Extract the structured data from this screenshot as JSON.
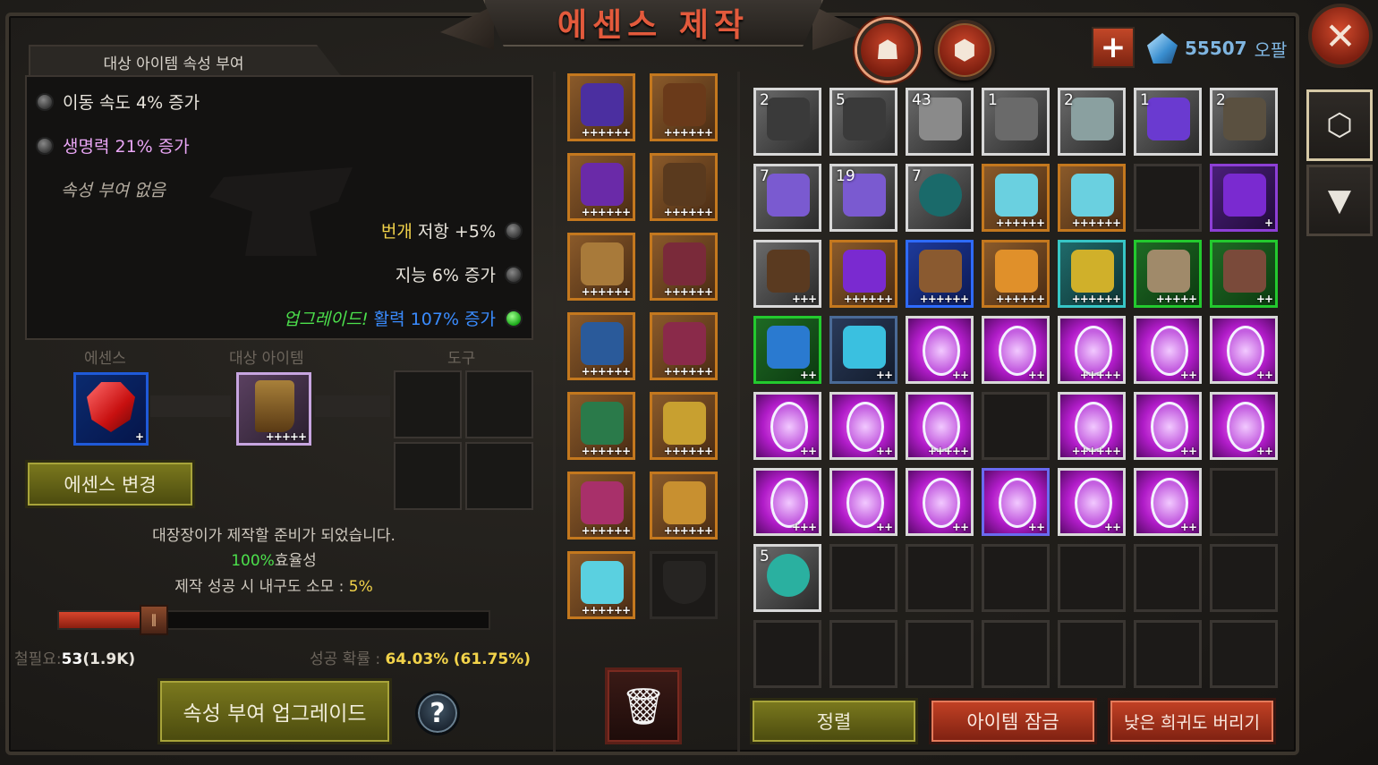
{
  "title": "에센스 제작",
  "currency": {
    "value": "55507",
    "unit": "오팔"
  },
  "attr_panel": {
    "tab_label": "대상 아이템 속성 부여",
    "rows": [
      {
        "text": "이동 속도 4% 증가",
        "color": "#e8e4dc"
      },
      {
        "text": "생명력 21% 증가",
        "color": "#e9a6f5"
      }
    ],
    "none_text": "속성 부여 없음",
    "right_rows": [
      {
        "prefix": "번개",
        "text": " 저항 +5%"
      },
      {
        "text": "지능 6% 증가"
      }
    ],
    "upgrade": {
      "prefix": "업그레이드!",
      "text": " 활력 107% 증가"
    }
  },
  "slots": {
    "essence_label": "에센스",
    "target_label": "대상 아이템",
    "tool_label": "도구",
    "essence_stars": "+",
    "target_stars": "+++++"
  },
  "buttons": {
    "change_essence": "에센스 변경",
    "upgrade": "속성 부여 업그레이드",
    "sort": "정렬",
    "lock": "아이템 잠금",
    "discard": "낮은 희귀도 버리기",
    "help": "?",
    "close": "✕",
    "plus": "+"
  },
  "status": {
    "ready": "대장장이가 제작할 준비가 되었습니다.",
    "efficiency_value": "100%",
    "efficiency_label": "효율성",
    "durability_label": "제작 성공 시 내구도 소모 : ",
    "durability_value": "5%",
    "iron_label": "철필요:",
    "iron_value": "53",
    "iron_total": "(1.9K)",
    "success_label": "성공 확률 : ",
    "success_value": "64.03%",
    "success_alt": "(61.75%)"
  },
  "slider": {
    "fill": 0.2
  },
  "equipment": [
    {
      "icon": "hat-icon",
      "stars": "++++++",
      "art": "#4b2fa0"
    },
    {
      "icon": "gloves-icon",
      "stars": "++++++",
      "art": "#6a3a1a"
    },
    {
      "icon": "amulet-icon",
      "stars": "++++++",
      "art": "#6a2aa8"
    },
    {
      "icon": "belt-icon",
      "stars": "++++++",
      "art": "#5a3a1e"
    },
    {
      "icon": "pauldron-icon",
      "stars": "++++++",
      "art": "#a87a3a"
    },
    {
      "icon": "pants-icon",
      "stars": "++++++",
      "art": "#7a2a3a"
    },
    {
      "icon": "armor-icon",
      "stars": "++++++",
      "art": "#2a5a9a"
    },
    {
      "icon": "boots-icon",
      "stars": "++++++",
      "art": "#8a2a4a"
    },
    {
      "icon": "cloak-icon",
      "stars": "++++++",
      "art": "#2a7a4a"
    },
    {
      "icon": "ring-icon",
      "stars": "++++++",
      "art": "#c8a030"
    },
    {
      "icon": "gem-bracer-icon",
      "stars": "++++++",
      "art": "#a8306a"
    },
    {
      "icon": "ring-icon",
      "stars": "++++++",
      "art": "#c89030"
    },
    {
      "icon": "crystal-icon",
      "stars": "++++++",
      "art": "#5ad0e0"
    },
    {
      "icon": "shield-slot-icon",
      "stars": "",
      "art": ""
    }
  ],
  "inventory": [
    {
      "icon": "anvil-icon",
      "count": "2",
      "stars": "",
      "rarity": "r-plain"
    },
    {
      "icon": "anvil-icon",
      "count": "5",
      "stars": "",
      "rarity": "r-plain"
    },
    {
      "icon": "ingot-icon",
      "count": "43",
      "stars": "",
      "rarity": "r-plain"
    },
    {
      "icon": "blade-icon",
      "count": "1",
      "stars": "",
      "rarity": "r-plain"
    },
    {
      "icon": "thread-icon",
      "count": "2",
      "stars": "",
      "rarity": "r-plain"
    },
    {
      "icon": "purple-crystal-icon",
      "count": "1",
      "stars": "",
      "rarity": "r-plain"
    },
    {
      "icon": "pyramid-icon",
      "count": "2",
      "stars": "",
      "rarity": "r-plain"
    },
    {
      "icon": "hammer-icon",
      "count": "7",
      "stars": "",
      "rarity": "r-plain"
    },
    {
      "icon": "hammer-icon",
      "count": "19",
      "stars": "",
      "rarity": "r-plain"
    },
    {
      "icon": "orb-icon",
      "count": "7",
      "stars": "",
      "rarity": "r-plain"
    },
    {
      "icon": "crystal-icon",
      "count": "",
      "stars": "++++++",
      "rarity": "r-orange"
    },
    {
      "icon": "crystal-icon",
      "count": "",
      "stars": "++++++",
      "rarity": "r-orange"
    },
    {
      "icon": "",
      "count": "",
      "stars": "",
      "rarity": "empty"
    },
    {
      "icon": "amulet-icon",
      "count": "",
      "stars": "+",
      "rarity": "r-purple"
    },
    {
      "icon": "bracer-icon",
      "count": "",
      "stars": "+++",
      "rarity": "r-plain"
    },
    {
      "icon": "amulet-icon",
      "count": "",
      "stars": "++++++",
      "rarity": "r-orange"
    },
    {
      "icon": "boots-icon",
      "count": "",
      "stars": "++++++",
      "rarity": "r-blue"
    },
    {
      "icon": "feather-icon",
      "count": "",
      "stars": "++++++",
      "rarity": "r-orange"
    },
    {
      "icon": "shield-icon",
      "count": "",
      "stars": "++++++",
      "rarity": "r-cyan"
    },
    {
      "icon": "dagger-icon",
      "count": "",
      "stars": "+++++",
      "rarity": "r-green"
    },
    {
      "icon": "wing-icon",
      "count": "",
      "stars": "++",
      "rarity": "r-green"
    },
    {
      "icon": "emblem-icon",
      "count": "",
      "stars": "++",
      "rarity": "r-green"
    },
    {
      "icon": "wand-icon",
      "count": "",
      "stars": "++",
      "rarity": "r-bluegray"
    },
    {
      "icon": "void-gem-icon",
      "count": "",
      "stars": "++",
      "rarity": "r-void"
    },
    {
      "icon": "void-gem-icon",
      "count": "",
      "stars": "++",
      "rarity": "r-void"
    },
    {
      "icon": "void-gem-icon",
      "count": "",
      "stars": "+++++",
      "rarity": "r-void"
    },
    {
      "icon": "void-gem-icon",
      "count": "",
      "stars": "++",
      "rarity": "r-void"
    },
    {
      "icon": "void-gem-icon",
      "count": "",
      "stars": "++",
      "rarity": "r-void"
    },
    {
      "icon": "void-gem-icon",
      "count": "",
      "stars": "++",
      "rarity": "r-void"
    },
    {
      "icon": "void-gem-icon",
      "count": "",
      "stars": "++",
      "rarity": "r-void"
    },
    {
      "icon": "void-gem-icon",
      "count": "",
      "stars": "+++++",
      "rarity": "r-void"
    },
    {
      "icon": "",
      "count": "",
      "stars": "",
      "rarity": "empty"
    },
    {
      "icon": "void-gem-icon",
      "count": "",
      "stars": "++++++",
      "rarity": "r-void"
    },
    {
      "icon": "void-gem-icon",
      "count": "",
      "stars": "++",
      "rarity": "r-void"
    },
    {
      "icon": "void-gem-icon",
      "count": "",
      "stars": "++",
      "rarity": "r-void"
    },
    {
      "icon": "void-gem-icon",
      "count": "",
      "stars": "+++",
      "rarity": "r-void"
    },
    {
      "icon": "void-gem-icon",
      "count": "",
      "stars": "++",
      "rarity": "r-void"
    },
    {
      "icon": "void-gem-icon",
      "count": "",
      "stars": "++",
      "rarity": "r-void"
    },
    {
      "icon": "void-gem-icon",
      "count": "",
      "stars": "++",
      "rarity": "r-void b-blue"
    },
    {
      "icon": "void-gem-icon",
      "count": "",
      "stars": "++",
      "rarity": "r-void"
    },
    {
      "icon": "void-gem-icon",
      "count": "",
      "stars": "++",
      "rarity": "r-void"
    },
    {
      "icon": "",
      "count": "",
      "stars": "",
      "rarity": "empty"
    },
    {
      "icon": "pearl-icon",
      "count": "5",
      "stars": "",
      "rarity": "r-plain"
    },
    {
      "icon": "",
      "count": "",
      "stars": "",
      "rarity": "empty"
    },
    {
      "icon": "",
      "count": "",
      "stars": "",
      "rarity": "empty"
    },
    {
      "icon": "",
      "count": "",
      "stars": "",
      "rarity": "empty"
    },
    {
      "icon": "",
      "count": "",
      "stars": "",
      "rarity": "empty"
    },
    {
      "icon": "",
      "count": "",
      "stars": "",
      "rarity": "empty"
    },
    {
      "icon": "",
      "count": "",
      "stars": "",
      "rarity": "empty"
    },
    {
      "icon": "",
      "count": "",
      "stars": "",
      "rarity": "empty"
    },
    {
      "icon": "",
      "count": "",
      "stars": "",
      "rarity": "empty"
    },
    {
      "icon": "",
      "count": "",
      "stars": "",
      "rarity": "empty"
    },
    {
      "icon": "",
      "count": "",
      "stars": "",
      "rarity": "empty"
    },
    {
      "icon": "",
      "count": "",
      "stars": "",
      "rarity": "empty"
    },
    {
      "icon": "",
      "count": "",
      "stars": "",
      "rarity": "empty"
    },
    {
      "icon": "",
      "count": "",
      "stars": "",
      "rarity": "empty"
    }
  ]
}
